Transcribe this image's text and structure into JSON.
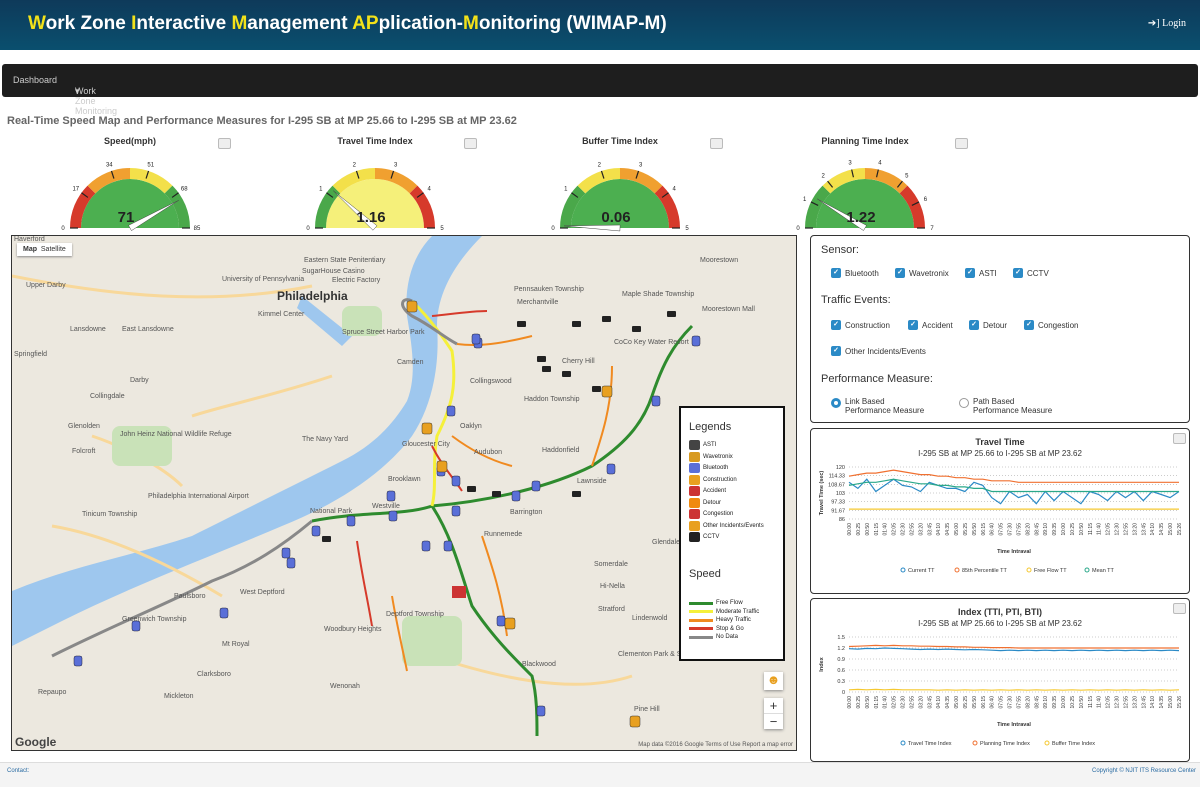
{
  "app": {
    "title_parts": [
      {
        "t": "W",
        "y": true
      },
      {
        "t": "ork Zone ",
        "y": false
      },
      {
        "t": "I",
        "y": true
      },
      {
        "t": "nteractive ",
        "y": false
      },
      {
        "t": "M",
        "y": true
      },
      {
        "t": "anagement ",
        "y": false
      },
      {
        "t": "AP",
        "y": true
      },
      {
        "t": "plication-",
        "y": false
      },
      {
        "t": "M",
        "y": true
      },
      {
        "t": "onitoring (WIMAP-M)",
        "y": false
      }
    ],
    "login": "Login"
  },
  "nav": {
    "dashboard": "Dashboard",
    "monitoring": "Work Zone Monitoring"
  },
  "page_title": "Real-Time Speed Map and Performance Measures for I-295 SB at MP 25.66 to I-295 SB at MP 23.62",
  "gauges": [
    {
      "title": "Speed(mph)",
      "value": "71",
      "ticks": [
        "0",
        "17",
        "34",
        "51",
        "68",
        "85"
      ],
      "min": 0,
      "max": 85,
      "v": 71,
      "bands": [
        "#d63a2b",
        "#f0a030",
        "#f3e04a",
        "#4aa84a"
      ],
      "face": "#4caf50"
    },
    {
      "title": "Travel Time Index",
      "value": "1.16",
      "ticks": [
        "0",
        "1",
        "2",
        "3",
        "4",
        "5"
      ],
      "min": 0,
      "max": 5,
      "v": 1.16,
      "bands": [
        "#4aa84a",
        "#f3e04a",
        "#f0a030",
        "#d63a2b"
      ],
      "face": "#f5f07a"
    },
    {
      "title": "Buffer Time Index",
      "value": "0.06",
      "ticks": [
        "0",
        "1",
        "2",
        "3",
        "4",
        "5"
      ],
      "min": 0,
      "max": 5,
      "v": 0.06,
      "bands": [
        "#4aa84a",
        "#f3e04a",
        "#f0a030",
        "#d63a2b"
      ],
      "face": "#4caf50"
    },
    {
      "title": "Planning Time Index",
      "value": "1.22",
      "ticks": [
        "0",
        "1",
        "2",
        "3",
        "4",
        "5",
        "6",
        "7"
      ],
      "min": 0,
      "max": 7,
      "v": 1.22,
      "bands": [
        "#4aa84a",
        "#f3e04a",
        "#f0a030",
        "#d63a2b"
      ],
      "face": "#4caf50"
    }
  ],
  "map": {
    "maptype": [
      "Map",
      "Satellite"
    ],
    "footer": "Map data ©2016 Google   Terms of Use   Report a map error",
    "google": "Google",
    "places": [
      "Haverford",
      "Upper Darby",
      "University of Pennsylvania",
      "Philadelphia",
      "Kimmel Center",
      "Eastern State Penitentiary",
      "SugarHouse Casino",
      "Electric Factory",
      "Lansdowne",
      "East Lansdowne",
      "Springfield",
      "Darby",
      "Collingdale",
      "Glenolden",
      "Folcroft",
      "John Heinz National Wildlife Refuge",
      "The Navy Yard",
      "Philadelphia International Airport",
      "Tinicum Township",
      "National Park",
      "West Deptford",
      "Paulsboro",
      "Greenwich Township",
      "Mt Royal",
      "Clarksboro",
      "Repaupo",
      "Mickleton",
      "Wenonah",
      "Woodbury Heights",
      "Deptford Township",
      "Runnemede",
      "Barrington",
      "Lawnside",
      "Glendale",
      "Somerdale",
      "Hi-Nella",
      "Stratford",
      "Lindenwold",
      "Clementon Park & Splash World",
      "Pine Hill",
      "Blackwood",
      "Gloucester City",
      "Audubon",
      "Oaklyn",
      "Haddonfield",
      "Haddon Township",
      "Collingswood",
      "Cherry Hill",
      "Pennsauken Township",
      "Merchantville",
      "Maple Shade Township",
      "Moorestown Mall",
      "Moorestown",
      "CoCo Key Water Resort",
      "Camden",
      "Brooklawn",
      "Westville",
      "Spruce Street Harbor Park"
    ]
  },
  "legend": {
    "title": "Legends",
    "items": [
      "ASTI",
      "Wavetronix",
      "Bluetooth",
      "Construction",
      "Accident",
      "Detour",
      "Congestion",
      "Other Incidents/Events",
      "CCTV"
    ],
    "icon_colors": [
      "#444",
      "#d89a20",
      "#5a6fd8",
      "#e8a020",
      "#c33",
      "#f08a10",
      "#c33",
      "#e8a020",
      "#222"
    ],
    "speed_title": "Speed",
    "speed": [
      {
        "label": "Free Flow",
        "color": "#2e8b2e"
      },
      {
        "label": "Moderate Traffic",
        "color": "#f5f03a"
      },
      {
        "label": "Heavy Traffic",
        "color": "#f08a20"
      },
      {
        "label": "Stop & Go",
        "color": "#d63a2b"
      },
      {
        "label": "No Data",
        "color": "#888888"
      }
    ]
  },
  "sensor": {
    "label": "Sensor:",
    "items": [
      "Bluetooth",
      "Wavetronix",
      "ASTI",
      "CCTV"
    ]
  },
  "events": {
    "label": "Traffic Events:",
    "items": [
      "Construction",
      "Accident",
      "Detour",
      "Congestion"
    ],
    "other": "Other Incidents/Events"
  },
  "measure": {
    "label": "Performance Measure:",
    "opt1a": "Link Based",
    "opt1b": "Performance Measure",
    "opt2a": "Path Based",
    "opt2b": "Performance Measure"
  },
  "chart_data": [
    {
      "type": "line",
      "title": "Travel Time",
      "subtitle": "I-295 SB at MP 25.66 to I-295 SB at MP 23.62",
      "ylabel": "Travel Time (sec)",
      "xlabel": "Time Intraval",
      "yticks": [
        "120",
        "114.33",
        "108.67",
        "103",
        "97.33",
        "91.67",
        "86"
      ],
      "ylim": [
        86,
        120
      ],
      "x": [
        "00:00",
        "00:25",
        "00:50",
        "01:15",
        "01:40",
        "02:05",
        "02:30",
        "02:55",
        "03:20",
        "03:45",
        "04:10",
        "04:35",
        "05:00",
        "05:25",
        "05:50",
        "06:15",
        "06:40",
        "07:05",
        "07:30",
        "07:55",
        "08:20",
        "08:45",
        "09:10",
        "09:35",
        "10:00",
        "10:25",
        "10:50",
        "11:15",
        "11:40",
        "12:05",
        "12:30",
        "12:55",
        "13:20",
        "13:45",
        "14:10",
        "14:35",
        "15:00",
        "15:26"
      ],
      "series": [
        {
          "name": "Current TT",
          "color": "#2b8ac6",
          "values": [
            110,
            106,
            112,
            104,
            108,
            112,
            108,
            107,
            104,
            110,
            108,
            106,
            106,
            104,
            110,
            108,
            100,
            96,
            104,
            100,
            102,
            96,
            104,
            98,
            104,
            100,
            96,
            104,
            102,
            98,
            104,
            100,
            104,
            98,
            104,
            102,
            100,
            104
          ]
        },
        {
          "name": "85th Percentile TT",
          "color": "#f07030",
          "values": [
            114,
            115,
            116,
            116,
            117,
            118,
            117,
            116,
            115,
            115,
            114,
            114,
            113,
            113,
            112,
            112,
            111,
            111,
            111,
            110,
            110,
            110,
            110,
            110,
            110,
            110,
            110,
            110,
            110,
            110,
            110,
            110,
            110,
            110,
            110,
            110,
            110,
            110
          ]
        },
        {
          "name": "Free Flow TT",
          "color": "#f5c830",
          "values": [
            92.5,
            92.5,
            92.5,
            92.5,
            92.5,
            92.5,
            92.5,
            92.5,
            92.5,
            92.5,
            92.5,
            92.5,
            92.5,
            92.5,
            92.5,
            92.5,
            92.5,
            92.5,
            92.5,
            92.5,
            92.5,
            92.5,
            92.5,
            92.5,
            92.5,
            92.5,
            92.5,
            92.5,
            92.5,
            92.5,
            92.5,
            92.5,
            92.5,
            92.5,
            92.5,
            92.5,
            92.5,
            92.5
          ]
        },
        {
          "name": "Mean TT",
          "color": "#2aa88a",
          "values": [
            108,
            109,
            110,
            110,
            111,
            112,
            111,
            110,
            109,
            109,
            108,
            108,
            107,
            107,
            106,
            106,
            104,
            104,
            104,
            104,
            104,
            104,
            104,
            104,
            104,
            104,
            104,
            104,
            104,
            104,
            104,
            104,
            104,
            104,
            104,
            104,
            104,
            104
          ]
        }
      ]
    },
    {
      "type": "line",
      "title": "Index (TTI, PTI, BTI)",
      "subtitle": "I-295 SB at MP 25.66 to I-295 SB at MP 23.62",
      "ylabel": "Index",
      "xlabel": "Time Intraval",
      "yticks": [
        "1.5",
        "1.2",
        "0.9",
        "0.6",
        "0.3",
        "0"
      ],
      "ylim": [
        0,
        1.5
      ],
      "x": [
        "00:00",
        "00:25",
        "00:50",
        "01:15",
        "01:40",
        "02:05",
        "02:30",
        "02:55",
        "03:20",
        "03:45",
        "04:10",
        "04:35",
        "05:00",
        "05:25",
        "05:50",
        "06:15",
        "06:40",
        "07:05",
        "07:30",
        "07:55",
        "08:20",
        "08:45",
        "09:10",
        "09:35",
        "10:00",
        "10:25",
        "10:50",
        "11:15",
        "11:40",
        "12:05",
        "12:30",
        "12:55",
        "13:20",
        "13:45",
        "14:10",
        "14:35",
        "15:00",
        "15:26"
      ],
      "series": [
        {
          "name": "Travel Time Index",
          "color": "#2b8ac6",
          "values": [
            1.18,
            1.17,
            1.19,
            1.18,
            1.2,
            1.19,
            1.18,
            1.17,
            1.16,
            1.17,
            1.16,
            1.17,
            1.16,
            1.15,
            1.16,
            1.15,
            1.14,
            1.13,
            1.14,
            1.13,
            1.14,
            1.13,
            1.14,
            1.13,
            1.14,
            1.13,
            1.14,
            1.13,
            1.14,
            1.13,
            1.14,
            1.13,
            1.14,
            1.13,
            1.14,
            1.13,
            1.14,
            1.13
          ]
        },
        {
          "name": "Planning Time Index",
          "color": "#f07030",
          "values": [
            1.24,
            1.25,
            1.26,
            1.27,
            1.26,
            1.27,
            1.26,
            1.26,
            1.25,
            1.25,
            1.24,
            1.24,
            1.23,
            1.23,
            1.22,
            1.22,
            1.21,
            1.21,
            1.21,
            1.2,
            1.2,
            1.2,
            1.2,
            1.2,
            1.2,
            1.2,
            1.2,
            1.2,
            1.2,
            1.2,
            1.2,
            1.2,
            1.2,
            1.2,
            1.2,
            1.2,
            1.2,
            1.2
          ]
        },
        {
          "name": "Buffer Time Index",
          "color": "#f5c830",
          "values": [
            0.06,
            0.07,
            0.06,
            0.07,
            0.06,
            0.07,
            0.06,
            0.06,
            0.06,
            0.06,
            0.05,
            0.06,
            0.05,
            0.06,
            0.05,
            0.06,
            0.05,
            0.06,
            0.05,
            0.06,
            0.05,
            0.06,
            0.05,
            0.06,
            0.05,
            0.06,
            0.05,
            0.06,
            0.05,
            0.06,
            0.05,
            0.06,
            0.05,
            0.06,
            0.05,
            0.06,
            0.05,
            0.06
          ]
        }
      ]
    }
  ],
  "footer": {
    "contact": "Contact:",
    "copyright": "Copyright © NJIT ITS Resource Center"
  }
}
